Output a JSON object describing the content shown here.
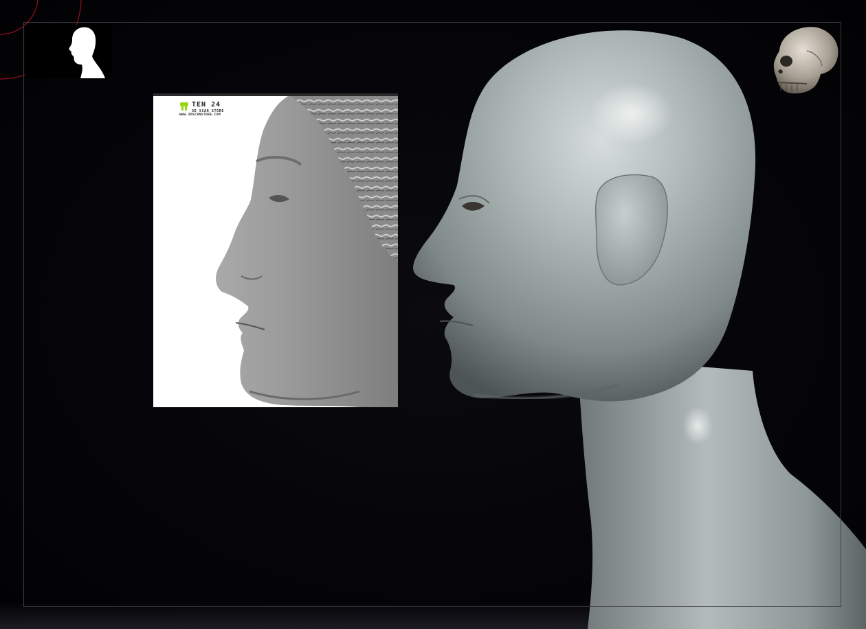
{
  "reference": {
    "watermark_title": "TEN 24",
    "watermark_subtitle": "3D SCAN STORE",
    "watermark_url": "WWW.3DSCANSTORE.COM"
  },
  "icons": {
    "head_profile": "head-silhouette-icon",
    "skull": "skull-thumbnail"
  },
  "colors": {
    "background": "#05050a",
    "frame": "#3c3c44",
    "accent_arc": "#b3121c",
    "sculpt_clay": "#a8b2b2",
    "watermark_green": "#9bd41a"
  }
}
